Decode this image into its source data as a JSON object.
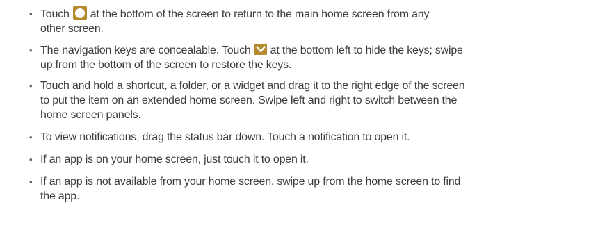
{
  "bullets": {
    "symbol": "•"
  },
  "items": [
    {
      "before_icon": "Touch",
      "icon": "home-circle-icon",
      "after_icon_line1": "at the bottom of the screen to return to the main home screen from any",
      "line2": "other screen."
    },
    {
      "before_icon": "The navigation keys are concealable. Touch",
      "icon": "chevron-down-icon",
      "after_icon_line1": "at the bottom left to hide the keys; swipe",
      "line2": "up from the bottom of the screen to restore the keys."
    },
    {
      "line1": "Touch and hold a shortcut, a folder, or a widget and drag it to the right edge of the screen",
      "line2": "to put the item on an extended home screen. Swipe left and right to switch between the",
      "line3": "home screen panels."
    },
    {
      "line1": "To view notifications, drag the status bar down. Touch a notification to open it."
    },
    {
      "line1": "If an app is on your home screen, just touch it to open it."
    },
    {
      "line1": "If an app is not available from your home screen, swipe up from the home screen to find",
      "line2": "the app."
    }
  ],
  "colors": {
    "text": "#3d3d3d",
    "icon_accent": "#b58a2e"
  }
}
